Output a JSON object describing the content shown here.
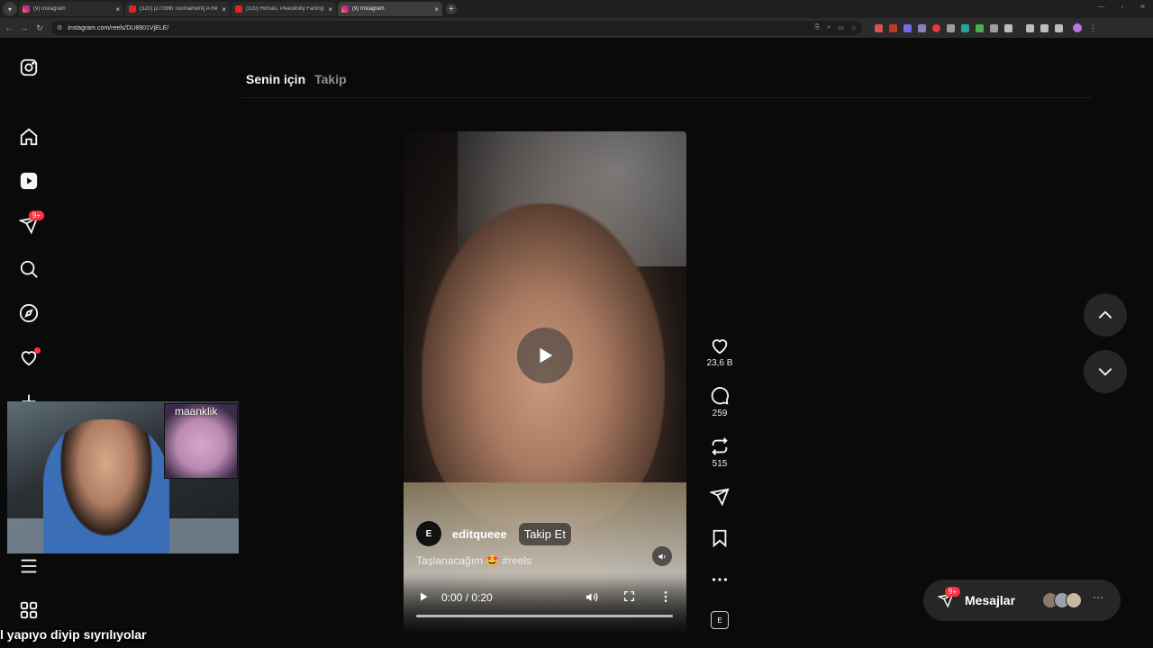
{
  "browser": {
    "tabs": [
      {
        "title": "(9) Instagram",
        "favicon": "instagram-icon"
      },
      {
        "title": "(320) [27/39th Tournament] A Re",
        "favicon": "youtube-icon"
      },
      {
        "title": "(320) Horses, Peacefully Farting",
        "favicon": "youtube-icon"
      },
      {
        "title": "(9) Instagram",
        "favicon": "instagram-icon"
      }
    ],
    "url": "instagram.com/reels/DU8901VjELE/"
  },
  "sidebar": {
    "items": [
      {
        "icon": "instagram-logo-icon"
      },
      {
        "icon": "home-icon"
      },
      {
        "icon": "reels-icon"
      },
      {
        "icon": "messages-icon",
        "badge": "9+"
      },
      {
        "icon": "search-icon"
      },
      {
        "icon": "explore-icon"
      },
      {
        "icon": "notifications-icon"
      },
      {
        "icon": "create-icon"
      },
      {
        "icon": "menu-icon"
      },
      {
        "icon": "more-apps-icon"
      }
    ]
  },
  "feed_tabs": {
    "for_you": "Senin için",
    "following": "Takip"
  },
  "reel": {
    "author": "editqueee",
    "avatar_text": "E",
    "follow_label": "Takip Et",
    "caption": "Taşlanacağım 🤩 #reels",
    "time": "0:00 / 0:20"
  },
  "actions": {
    "likes": "23,6 B",
    "comments": "259",
    "reposts": "515"
  },
  "messages": {
    "label": "Mesajlar",
    "badge": "9+"
  },
  "webcam": {
    "inset_text": "maanklik"
  },
  "subtitle": "l yapıyo diyip sıyrılıyolar",
  "colors": {
    "badge": "#ff3040",
    "bg": "#0a0a0a",
    "panel": "#262626"
  }
}
